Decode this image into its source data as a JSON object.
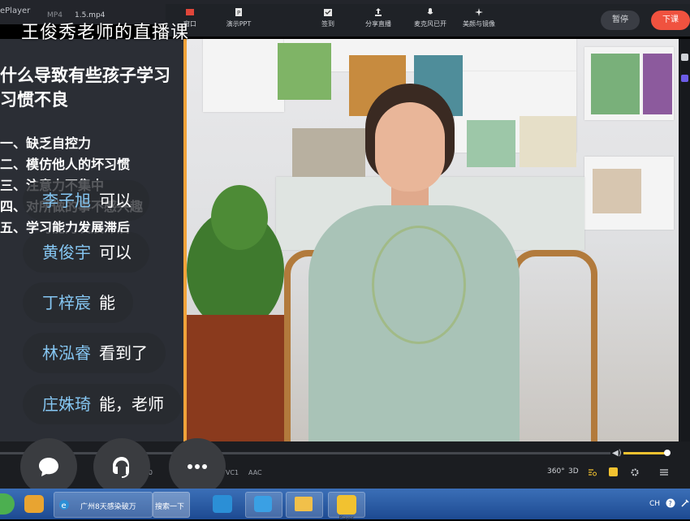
{
  "player": {
    "app_label": "ePlayer",
    "format_label": "MP4",
    "file_name": "1.5.mp4"
  },
  "toolbar": {
    "tools": [
      {
        "label": "窗口",
        "icon": "window-icon"
      },
      {
        "label": "演示PPT",
        "icon": "ppt-icon"
      },
      {
        "label": "签到",
        "icon": "checkin-icon"
      },
      {
        "label": "分享直播",
        "icon": "share-icon"
      },
      {
        "label": "麦克风已开",
        "icon": "microphone-icon"
      },
      {
        "label": "美颜与镜像",
        "icon": "beauty-icon"
      }
    ],
    "pause_label": "暂停",
    "end_label": "下课"
  },
  "stream_title": "王俊秀老师的直播课",
  "slide": {
    "heading": "什么导致有些孩子学习习惯不良",
    "points": [
      "一、缺乏自控力",
      "二、模仿他人的坏习惯",
      "三、注意力不集中",
      "四、对所做的事不感兴趣",
      "五、学习能力发展滞后"
    ]
  },
  "comments": [
    {
      "name": "李子旭",
      "text": "可以"
    },
    {
      "name": "黄俊宇",
      "text": "可以"
    },
    {
      "name": "丁梓宸",
      "text": "能"
    },
    {
      "name": "林泓睿",
      "text": "看到了"
    },
    {
      "name": "庄姝琦",
      "text": "能，老师"
    }
  ],
  "playback": {
    "progress_fraction": 0.0,
    "time_text": "2 / 0",
    "codec_labels": [
      "VC1",
      "AAC"
    ],
    "right_controls": [
      "360°",
      "3D"
    ]
  },
  "taskbar": {
    "browser_tab": "广州8天感染破万",
    "search_label": "搜索一下",
    "player_app": "Player",
    "tray_lang": "CH"
  },
  "colors": {
    "accent": "#f2a33a",
    "end_button": "#f0523f",
    "comment_name": "#86c7f3"
  }
}
